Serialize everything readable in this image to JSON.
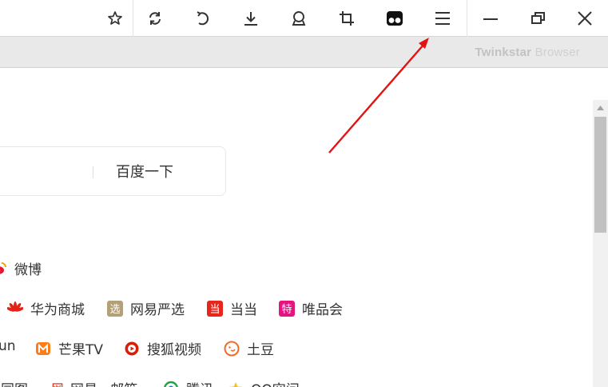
{
  "toolbar": {
    "icons": [
      "bookmark-star-icon",
      "refresh-icon",
      "undo-icon",
      "download-icon",
      "badge-icon",
      "crop-icon",
      "extension-icon",
      "menu-icon",
      "minimize-icon",
      "restore-icon",
      "close-icon"
    ]
  },
  "brand": {
    "bold": "Twinkstar",
    "light": " Browser"
  },
  "search": {
    "button_label": "百度一下"
  },
  "links": {
    "weibo": "微博",
    "huawei": "华为商城",
    "wangyi_yanxuan": "网易严选",
    "dangdang": "当当",
    "vip": "唯品会",
    "xun_partial": "un",
    "mango": "芒果TV",
    "sohu_video": "搜狐视频",
    "tudou": "土豆",
    "row4_a": "同图",
    "row4_b": "网易 · 邮箱",
    "row4_c": "腾讯",
    "row4_d": "QQ空间"
  },
  "colors": {
    "annotation_arrow": "#e31313",
    "toolbar_icon": "#333333"
  }
}
